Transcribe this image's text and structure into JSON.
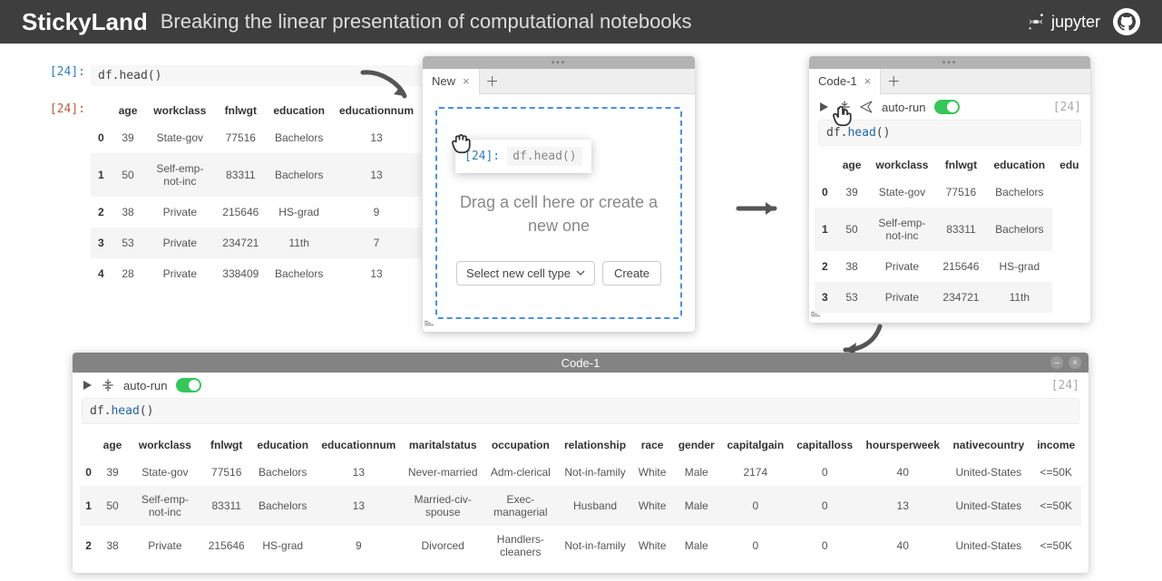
{
  "header": {
    "title": "StickyLand",
    "subtitle": "Breaking the linear presentation of computational notebooks",
    "jupyter_label": "jupyter"
  },
  "notebook": {
    "in_prompt": "[24]:",
    "code": "df.head()",
    "out_prompt": "[24]:",
    "columns": [
      "",
      "age",
      "workclass",
      "fnlwgt",
      "education",
      "educationnum"
    ],
    "rows": [
      [
        "0",
        "39",
        "State-gov",
        "77516",
        "Bachelors",
        "13"
      ],
      [
        "1",
        "50",
        "Self-emp-not-inc",
        "83311",
        "Bachelors",
        "13"
      ],
      [
        "2",
        "38",
        "Private",
        "215646",
        "HS-grad",
        "9"
      ],
      [
        "3",
        "53",
        "Private",
        "234721",
        "11th",
        "7"
      ],
      [
        "4",
        "28",
        "Private",
        "338409",
        "Bachelors",
        "13"
      ]
    ]
  },
  "sticky_new": {
    "tab": "New",
    "ghost_prompt": "[24]:",
    "ghost_code": "df.head()",
    "hint": "Drag a cell here or create a new one",
    "select_label": "Select new cell type",
    "create_label": "Create"
  },
  "sticky_code": {
    "tab": "Code-1",
    "autorun": "auto-run",
    "exec": "[24]",
    "code_prefix": "df.",
    "code_fn": "head",
    "code_suffix": "()",
    "columns": [
      "",
      "age",
      "workclass",
      "fnlwgt",
      "education",
      "edu"
    ],
    "rows": [
      [
        "0",
        "39",
        "State-gov",
        "77516",
        "Bachelors"
      ],
      [
        "1",
        "50",
        "Self-emp-not-inc",
        "83311",
        "Bachelors"
      ],
      [
        "2",
        "38",
        "Private",
        "215646",
        "HS-grad"
      ],
      [
        "3",
        "53",
        "Private",
        "234721",
        "11th"
      ]
    ]
  },
  "expanded": {
    "title": "Code-1",
    "autorun": "auto-run",
    "exec": "[24]",
    "code_prefix": "df.",
    "code_fn": "head",
    "code_suffix": "()",
    "columns": [
      "",
      "age",
      "workclass",
      "fnlwgt",
      "education",
      "educationnum",
      "maritalstatus",
      "occupation",
      "relationship",
      "race",
      "gender",
      "capitalgain",
      "capitalloss",
      "hoursperweek",
      "nativecountry",
      "income"
    ],
    "rows": [
      [
        "0",
        "39",
        "State-gov",
        "77516",
        "Bachelors",
        "13",
        "Never-married",
        "Adm-clerical",
        "Not-in-family",
        "White",
        "Male",
        "2174",
        "0",
        "40",
        "United-States",
        "<=50K"
      ],
      [
        "1",
        "50",
        "Self-emp-not-inc",
        "83311",
        "Bachelors",
        "13",
        "Married-civ-spouse",
        "Exec-managerial",
        "Husband",
        "White",
        "Male",
        "0",
        "0",
        "13",
        "United-States",
        "<=50K"
      ],
      [
        "2",
        "38",
        "Private",
        "215646",
        "HS-grad",
        "9",
        "Divorced",
        "Handlers-cleaners",
        "Not-in-family",
        "White",
        "Male",
        "0",
        "0",
        "40",
        "United-States",
        "<=50K"
      ]
    ]
  }
}
